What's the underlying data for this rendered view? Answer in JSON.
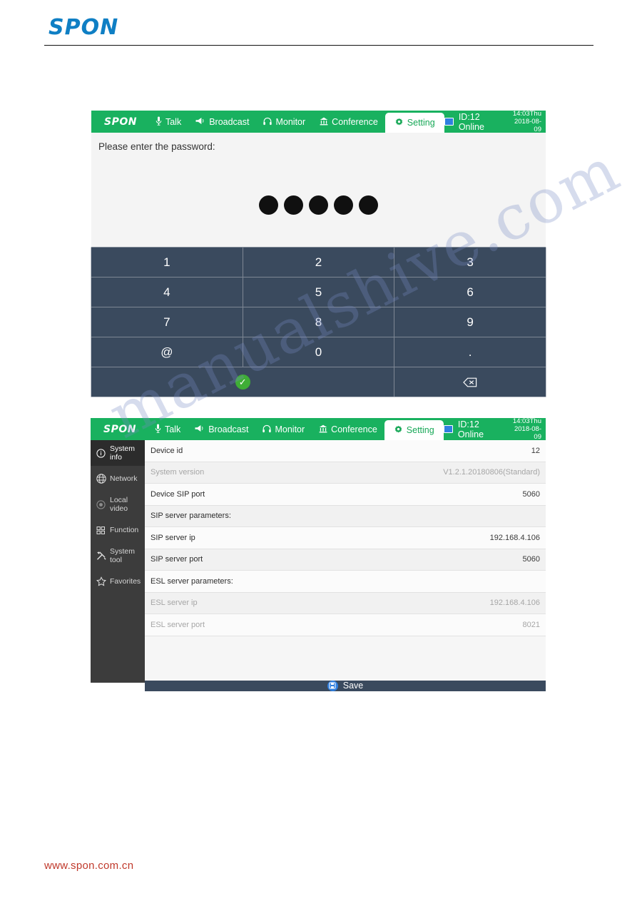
{
  "page": {
    "logo": "SPON",
    "footer_url": "www.spon.com.cn",
    "watermark": "manualshive.com"
  },
  "topbar": {
    "brand": "SPON",
    "nav": [
      {
        "label": "Talk",
        "icon": "microphone-icon"
      },
      {
        "label": "Broadcast",
        "icon": "megaphone-icon"
      },
      {
        "label": "Monitor",
        "icon": "headphone-icon"
      },
      {
        "label": "Conference",
        "icon": "bank-icon"
      },
      {
        "label": "Setting",
        "icon": "gear-icon"
      }
    ],
    "status": "ID:12 Online",
    "time": "14:03Thu",
    "date": "2018-08-09"
  },
  "password_screen": {
    "prompt": "Please enter the password:",
    "dots": 5,
    "keys": [
      "1",
      "2",
      "3",
      "4",
      "5",
      "6",
      "7",
      "8",
      "9",
      "@",
      "0",
      "."
    ],
    "confirm_icon": "check-circle-icon",
    "backspace_icon": "backspace-icon"
  },
  "settings_screen": {
    "menu": [
      {
        "label": "System info",
        "icon": "info-icon",
        "active": true
      },
      {
        "label": "Network",
        "icon": "globe-icon",
        "active": false
      },
      {
        "label": "Local video",
        "icon": "camera-icon",
        "active": false
      },
      {
        "label": "Function",
        "icon": "grid-icon",
        "active": false
      },
      {
        "label": "System tool",
        "icon": "tools-icon",
        "active": false
      },
      {
        "label": "Favorites",
        "icon": "star-icon",
        "active": false
      }
    ],
    "rows": [
      {
        "label": "Device id",
        "value": "12",
        "dim": false,
        "alt": false
      },
      {
        "label": "System version",
        "value": "V1.2.1.20180806(Standard)",
        "dim": true,
        "alt": true
      },
      {
        "label": "Device SIP port",
        "value": "5060",
        "dim": false,
        "alt": false
      },
      {
        "label": "SIP server parameters:",
        "value": "",
        "dim": false,
        "alt": true
      },
      {
        "label": "SIP server ip",
        "value": "192.168.4.106",
        "dim": false,
        "alt": false
      },
      {
        "label": "SIP server port",
        "value": "5060",
        "dim": false,
        "alt": true
      },
      {
        "label": "ESL server parameters:",
        "value": "",
        "dim": false,
        "alt": false
      },
      {
        "label": "ESL server ip",
        "value": "192.168.4.106",
        "dim": true,
        "alt": true
      },
      {
        "label": "ESL server port",
        "value": "8021",
        "dim": true,
        "alt": false
      }
    ],
    "save_label": "Save",
    "save_icon": "save-icon"
  },
  "colors": {
    "green": "#19b15f",
    "navy": "#3a4a5e",
    "logo_blue": "#0f7fc4",
    "footer_red": "#c0392b"
  }
}
